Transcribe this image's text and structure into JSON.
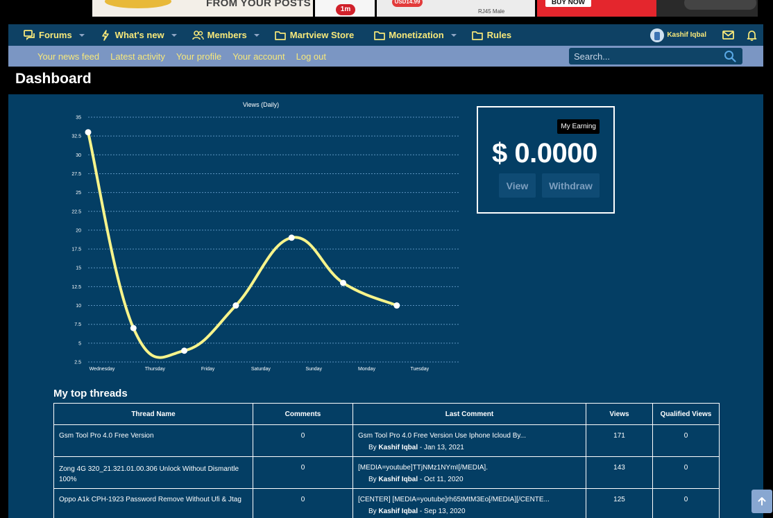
{
  "banners": {
    "ad1_text": "FROM YOUR POSTS",
    "ad2_badge": "1m",
    "ad3_price": "USD14.99",
    "ad3_caption": "RJ45 Male",
    "ad4_button": "BUY NOW"
  },
  "nav": {
    "items": [
      {
        "label": "Forums",
        "icon": "forums-icon",
        "caret": true
      },
      {
        "label": "What's new",
        "icon": "bolt-icon",
        "caret": true
      },
      {
        "label": "Members",
        "icon": "members-icon",
        "caret": true
      },
      {
        "label": "Martview Store",
        "icon": "folder-icon",
        "caret": false
      },
      {
        "label": "Monetization",
        "icon": "folder-icon",
        "caret": true
      },
      {
        "label": "Rules",
        "icon": "folder-icon",
        "caret": false
      }
    ],
    "user_name": "Kashif Iqbal"
  },
  "subnav": {
    "links": [
      "Your news feed",
      "Latest activity",
      "Your profile",
      "Your account",
      "Log out"
    ],
    "search_placeholder": "Search..."
  },
  "page": {
    "title": "Dashboard"
  },
  "chart_data": {
    "type": "line",
    "title": "Views (Daily)",
    "categories": [
      "Wednesday",
      "Thursday",
      "Friday",
      "Saturday",
      "Sunday",
      "Monday",
      "Tuesday"
    ],
    "series": [
      {
        "values": [
          33,
          7,
          4,
          10,
          19,
          13,
          10
        ],
        "color": "#f7f48b"
      }
    ],
    "ylim": [
      2.5,
      35
    ],
    "yticks": [
      "2.5",
      "5",
      "7.5",
      "10",
      "12.5",
      "15",
      "17.5",
      "20",
      "22.5",
      "25",
      "27.5",
      "30",
      "32.5",
      "35"
    ],
    "grid": true,
    "xlabel": "",
    "ylabel": ""
  },
  "earnings": {
    "tag": "My Earning",
    "amount": "$ 0.0000",
    "view_label": "View",
    "withdraw_label": "Withdraw"
  },
  "threads": {
    "title": "My top threads",
    "columns": [
      "Thread Name",
      "Comments",
      "Last Comment",
      "Views",
      "Qualified Views"
    ],
    "rows": [
      {
        "name": "Gsm Tool Pro 4.0 Free Version",
        "comments": "0",
        "last_comment": "Gsm Tool Pro 4.0 Free Version Use Iphone Icloud By...",
        "by_prefix": "By",
        "by_user": "Kashif Iqbal",
        "date": "- Jan 13, 2021",
        "views": "171",
        "qualified": "0"
      },
      {
        "name": "Zong 4G 320_21.321.01.00.306 Unlock Without Dismantle 100%",
        "comments": "0",
        "last_comment": "[MEDIA=youtube]TTjNMz1NYmI[/MEDIA].",
        "by_prefix": "By",
        "by_user": "Kashif Iqbal",
        "date": "- Oct 11, 2020",
        "views": "143",
        "qualified": "0"
      },
      {
        "name": "Oppo A1k CPH-1923 Password Remove Without Ufi & Jtag",
        "comments": "0",
        "last_comment": "[CENTER] [MEDIA=youtube]rh65tMtM3Eo[/MEDIA][/CENTE...",
        "by_prefix": "By",
        "by_user": "Kashif Iqbal",
        "date": "- Sep 13, 2020",
        "views": "125",
        "qualified": "0"
      }
    ]
  },
  "colors": {
    "nav_bg": "#0e4164",
    "subnav_bg": "#7b96c3",
    "nav_text": "#f7e87a",
    "panel_bg": "#043e64",
    "line": "#f7f48b"
  }
}
